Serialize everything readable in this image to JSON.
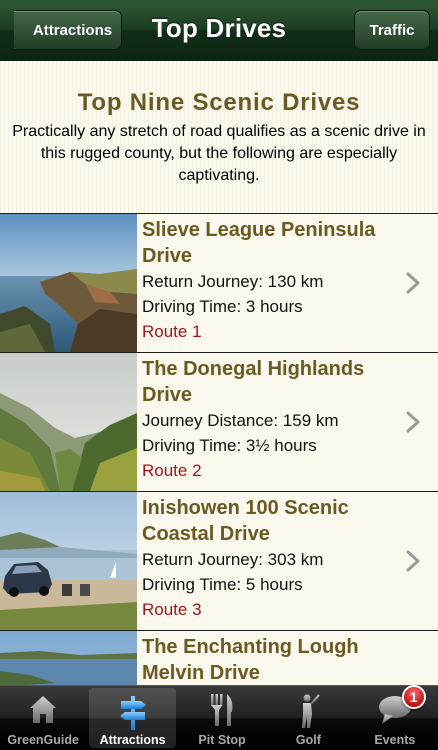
{
  "navbar": {
    "title": "Top Drives",
    "back_label": "Attractions",
    "right_label": "Traffic"
  },
  "intro": {
    "heading": "Top Nine Scenic Drives",
    "description": "Practically any stretch of road qualifies as a scenic drive in this rugged county, but the following are especially captivating."
  },
  "drives": [
    {
      "title": "Slieve League Peninsula Drive",
      "distance": "Return Journey: 130 km",
      "time": "Driving Time: 3 hours",
      "route": "Route 1"
    },
    {
      "title": "The Donegal Highlands Drive",
      "distance": "Journey Distance: 159 km",
      "time": "Driving Time: 3½ hours",
      "route": "Route 2"
    },
    {
      "title": "Inishowen 100 Scenic Coastal Drive",
      "distance": "Return Journey: 303 km",
      "time": "Driving Time: 5 hours",
      "route": "Route 3"
    },
    {
      "title": "The Enchanting Lough Melvin Drive"
    }
  ],
  "tabbar": {
    "tabs": [
      {
        "label": "GreenGuide",
        "icon": "house-icon"
      },
      {
        "label": "Attractions",
        "icon": "signpost-icon"
      },
      {
        "label": "Pit Stop",
        "icon": "fork-knife-icon"
      },
      {
        "label": "Golf",
        "icon": "golfer-icon"
      },
      {
        "label": "Events",
        "icon": "speech-bubble-icon"
      }
    ],
    "active_tab": "Attractions",
    "events_badge": "1"
  },
  "colors": {
    "navbar_green": "#1b3d22",
    "heading_olive": "#6a5a22",
    "route_red": "#a3151d",
    "badge_red": "#c40f14"
  }
}
